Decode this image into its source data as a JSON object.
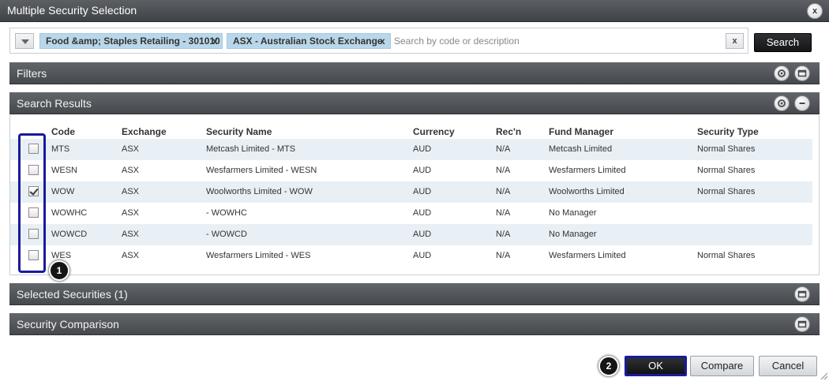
{
  "window": {
    "title": "Multiple Security Selection",
    "close_label": "x"
  },
  "search": {
    "tags": [
      {
        "label": "Food &amp; Staples Retailing - 301010",
        "remove": "x"
      },
      {
        "label": "ASX - Australian Stock Exchange",
        "remove": "x"
      }
    ],
    "placeholder": "Search by code or description",
    "clear_label": "x",
    "search_button": "Search"
  },
  "sections": {
    "filters": "Filters",
    "results": "Search Results",
    "selected": "Selected Securities (1)",
    "comparison": "Security Comparison"
  },
  "table": {
    "headers": [
      "Code",
      "Exchange",
      "Security Name",
      "Currency",
      "Rec'n",
      "Fund Manager",
      "Security Type"
    ],
    "rows": [
      {
        "checked": false,
        "code": "MTS",
        "exchange": "ASX",
        "name": "Metcash Limited - MTS",
        "currency": "AUD",
        "recn": "N/A",
        "manager": "Metcash Limited",
        "type": "Normal Shares"
      },
      {
        "checked": false,
        "code": "WESN",
        "exchange": "ASX",
        "name": "Wesfarmers Limited - WESN",
        "currency": "AUD",
        "recn": "N/A",
        "manager": "Wesfarmers Limited",
        "type": "Normal Shares"
      },
      {
        "checked": true,
        "code": "WOW",
        "exchange": "ASX",
        "name": "Woolworths Limited - WOW",
        "currency": "AUD",
        "recn": "N/A",
        "manager": "Woolworths Limited",
        "type": "Normal Shares"
      },
      {
        "checked": false,
        "code": "WOWHC",
        "exchange": "ASX",
        "name": "- WOWHC",
        "currency": "AUD",
        "recn": "N/A",
        "manager": "No Manager",
        "type": ""
      },
      {
        "checked": false,
        "code": "WOWCD",
        "exchange": "ASX",
        "name": "- WOWCD",
        "currency": "AUD",
        "recn": "N/A",
        "manager": "No Manager",
        "type": ""
      },
      {
        "checked": false,
        "code": "WES",
        "exchange": "ASX",
        "name": "Wesfarmers Limited - WES",
        "currency": "AUD",
        "recn": "N/A",
        "manager": "Wesfarmers Limited",
        "type": "Normal Shares"
      }
    ]
  },
  "callouts": {
    "one": "1",
    "two": "2"
  },
  "footer": {
    "ok": "OK",
    "compare": "Compare",
    "cancel": "Cancel"
  },
  "colors": {
    "header_bar": "#45484c",
    "tag_bg": "#b9d7ea",
    "row_alt": "#e8f0f6",
    "annotation": "#1a1a9a"
  }
}
